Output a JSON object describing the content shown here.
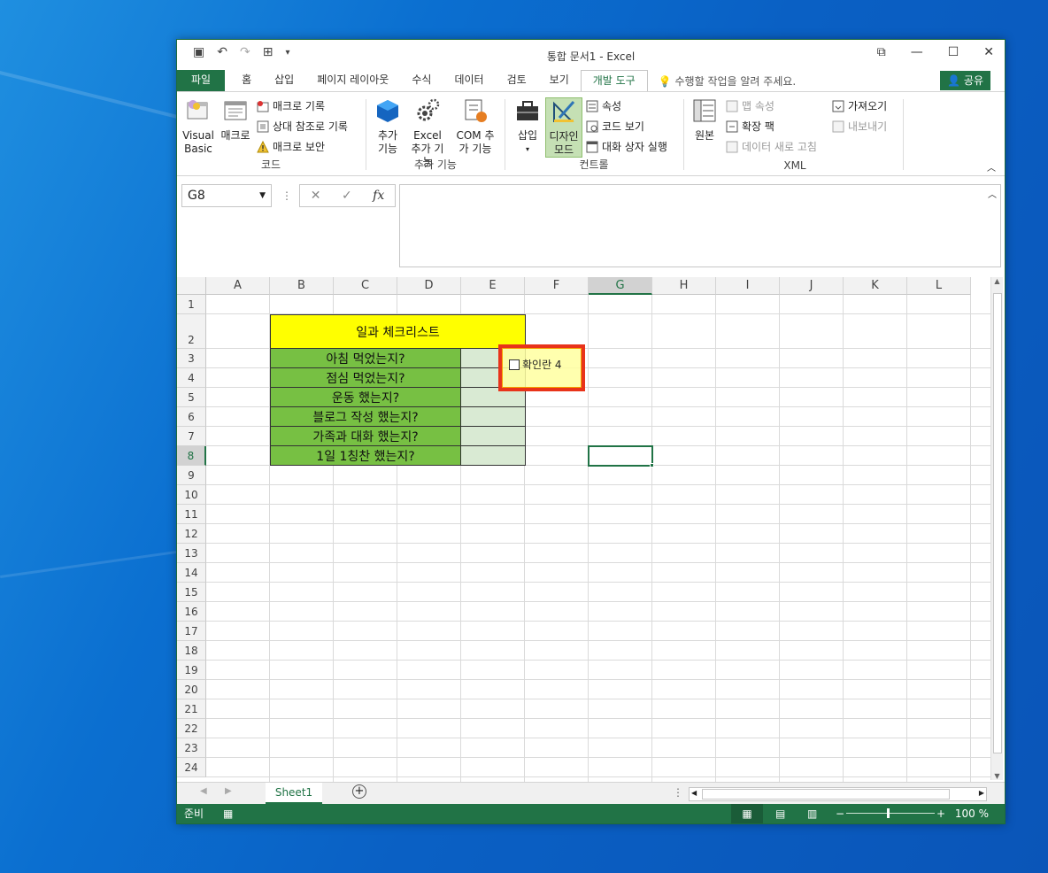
{
  "window": {
    "title": "통합 문서1 - Excel"
  },
  "tabs": [
    {
      "label": "파일"
    },
    {
      "label": "홈"
    },
    {
      "label": "삽입"
    },
    {
      "label": "페이지 레이아웃"
    },
    {
      "label": "수식"
    },
    {
      "label": "데이터"
    },
    {
      "label": "검토"
    },
    {
      "label": "보기"
    },
    {
      "label": "개발 도구"
    }
  ],
  "tell_me": "수행할 작업을 알려 주세요.",
  "share": "공유",
  "ribbon": {
    "code": {
      "label": "코드",
      "visual_basic": "Visual Basic",
      "macro": "매크로",
      "record": "매크로 기록",
      "relative": "상대 참조로 기록",
      "security": "매크로 보안"
    },
    "addins": {
      "label": "추가 기능",
      "addins": "추가 기능",
      "excel_addins": "Excel 추가 기능",
      "com_addins": "COM 추가 기능"
    },
    "controls": {
      "label": "컨트롤",
      "insert": "삽입",
      "design": "디자인 모드",
      "properties": "속성",
      "view_code": "코드 보기",
      "run_dialog": "대화 상자 실행"
    },
    "xml": {
      "label": "XML",
      "source": "원본",
      "map_props": "맵 속성",
      "expansion": "확장 팩",
      "refresh": "데이터 새로 고침",
      "import": "가져오기",
      "export": "내보내기"
    }
  },
  "name_box": "G8",
  "fx": "fx",
  "columns": [
    "A",
    "B",
    "C",
    "D",
    "E",
    "F",
    "G",
    "H",
    "I",
    "J",
    "K",
    "L"
  ],
  "rows": [
    "1",
    "2",
    "3",
    "4",
    "5",
    "6",
    "7",
    "8",
    "9",
    "10",
    "11",
    "12",
    "13",
    "14",
    "15",
    "16",
    "17",
    "18",
    "19",
    "20",
    "21",
    "22",
    "23",
    "24"
  ],
  "checklist": {
    "title": "일과 체크리스트",
    "items": [
      "아침 먹었는지?",
      "점심 먹었는지?",
      "운동 했는지?",
      "블로그 작성 했는지?",
      "가족과 대화 했는지?",
      "1일 1칭찬 했는지?"
    ]
  },
  "checkbox": {
    "label": "확인란 4"
  },
  "sheet_tab": "Sheet1",
  "status": {
    "ready": "준비",
    "zoom": "100 %"
  },
  "colors": {
    "accent": "#217346",
    "title_fill": "#ffff00",
    "item_fill": "#77c043",
    "check_fill": "#d9ead3",
    "highlight": "#e8331a"
  }
}
